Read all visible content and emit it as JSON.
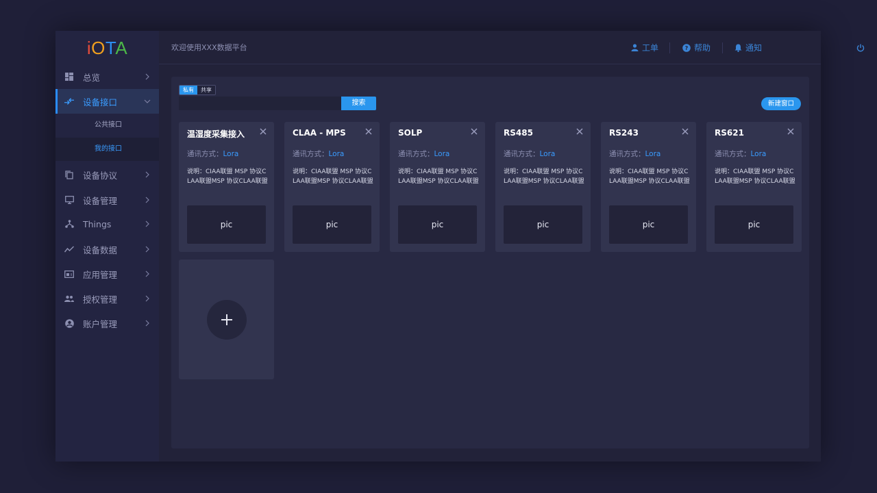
{
  "app": {
    "logo": {
      "c1": "i",
      "c2": "O",
      "c3": "T",
      "c4": "A"
    }
  },
  "sidebar": {
    "items": [
      {
        "label": "总览",
        "icon": "dashboard-icon"
      },
      {
        "label": "设备接口",
        "icon": "interface-icon",
        "active": true,
        "children": [
          {
            "label": "公共接口"
          },
          {
            "label": "我的接口",
            "selected": true
          }
        ]
      },
      {
        "label": "设备协议",
        "icon": "copy-icon"
      },
      {
        "label": "设备管理",
        "icon": "monitor-icon"
      },
      {
        "label": "Things",
        "icon": "hierarchy-icon"
      },
      {
        "label": "设备数据",
        "icon": "trend-icon"
      },
      {
        "label": "应用管理",
        "icon": "app-icon"
      },
      {
        "label": "授权管理",
        "icon": "group-icon"
      },
      {
        "label": "账户管理",
        "icon": "account-icon"
      }
    ]
  },
  "header": {
    "welcome": "欢迎使用XXX数据平台",
    "ticket_label": "工单",
    "help_label": "帮助",
    "notify_label": "通知"
  },
  "toolbar": {
    "tab_private": "私有",
    "tab_shared": "共享",
    "search_value": "",
    "search_label": "搜索",
    "new_window_label": "新建窗口"
  },
  "cards": [
    {
      "title": "温湿度采集接入",
      "mode_label": "通讯方式：",
      "mode_value": "Lora",
      "desc": "说明：CIAA联盟 MSP 协议CLAA联盟MSP 协议CLAA联盟",
      "pic": "pic"
    },
    {
      "title": "CLAA - MPS",
      "mode_label": "通讯方式：",
      "mode_value": "Lora",
      "desc": "说明：CIAA联盟 MSP 协议CLAA联盟MSP 协议CLAA联盟",
      "pic": "pic"
    },
    {
      "title": "SOLP",
      "mode_label": "通讯方式：",
      "mode_value": "Lora",
      "desc": "说明：CIAA联盟 MSP 协议CLAA联盟MSP 协议CLAA联盟",
      "pic": "pic"
    },
    {
      "title": "RS485",
      "mode_label": "通讯方式：",
      "mode_value": "Lora",
      "desc": "说明：CIAA联盟 MSP 协议CLAA联盟MSP 协议CLAA联盟",
      "pic": "pic"
    },
    {
      "title": "RS243",
      "mode_label": "通讯方式：",
      "mode_value": "Lora",
      "desc": "说明：CIAA联盟 MSP 协议CLAA联盟MSP 协议CLAA联盟",
      "pic": "pic"
    },
    {
      "title": "RS621",
      "mode_label": "通讯方式：",
      "mode_value": "Lora",
      "desc": "说明：CIAA联盟 MSP 协议CLAA联盟MSP 协议CLAA联盟",
      "pic": "pic"
    }
  ],
  "colors": {
    "accent": "#2a96ee",
    "background": "#1f1f38",
    "panel": "#282943",
    "card": "#32344f",
    "logo_i": "#e74c3c",
    "logo_o": "#f0a01e",
    "logo_t": "#2d8ef0",
    "logo_a": "#4cb848"
  }
}
